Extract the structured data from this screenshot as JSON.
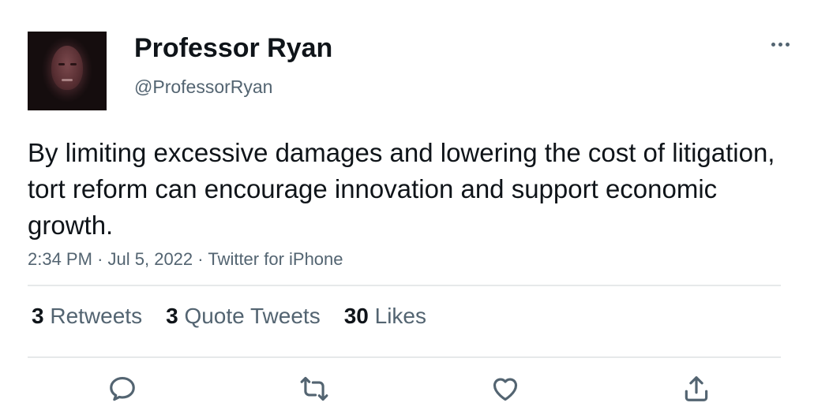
{
  "author": {
    "display_name": "Professor Ryan",
    "handle": "@ProfessorRyan"
  },
  "tweet": {
    "text": "By limiting excessive damages and lowering the cost of litigation, tort reform can encourage innovation and support economic growth.",
    "time": "2:34 PM",
    "separator": "·",
    "date": "Jul 5, 2022",
    "source": "Twitter for iPhone"
  },
  "stats": [
    {
      "count": "3",
      "label": "Retweets"
    },
    {
      "count": "3",
      "label": "Quote Tweets"
    },
    {
      "count": "30",
      "label": "Likes"
    }
  ],
  "icons": {
    "more": "more-icon",
    "reply": "reply-icon",
    "retweet": "retweet-icon",
    "like": "heart-icon",
    "share": "share-icon"
  },
  "colors": {
    "text_primary": "#0f1419",
    "text_secondary": "#536471",
    "divider": "#e6e9ea"
  }
}
